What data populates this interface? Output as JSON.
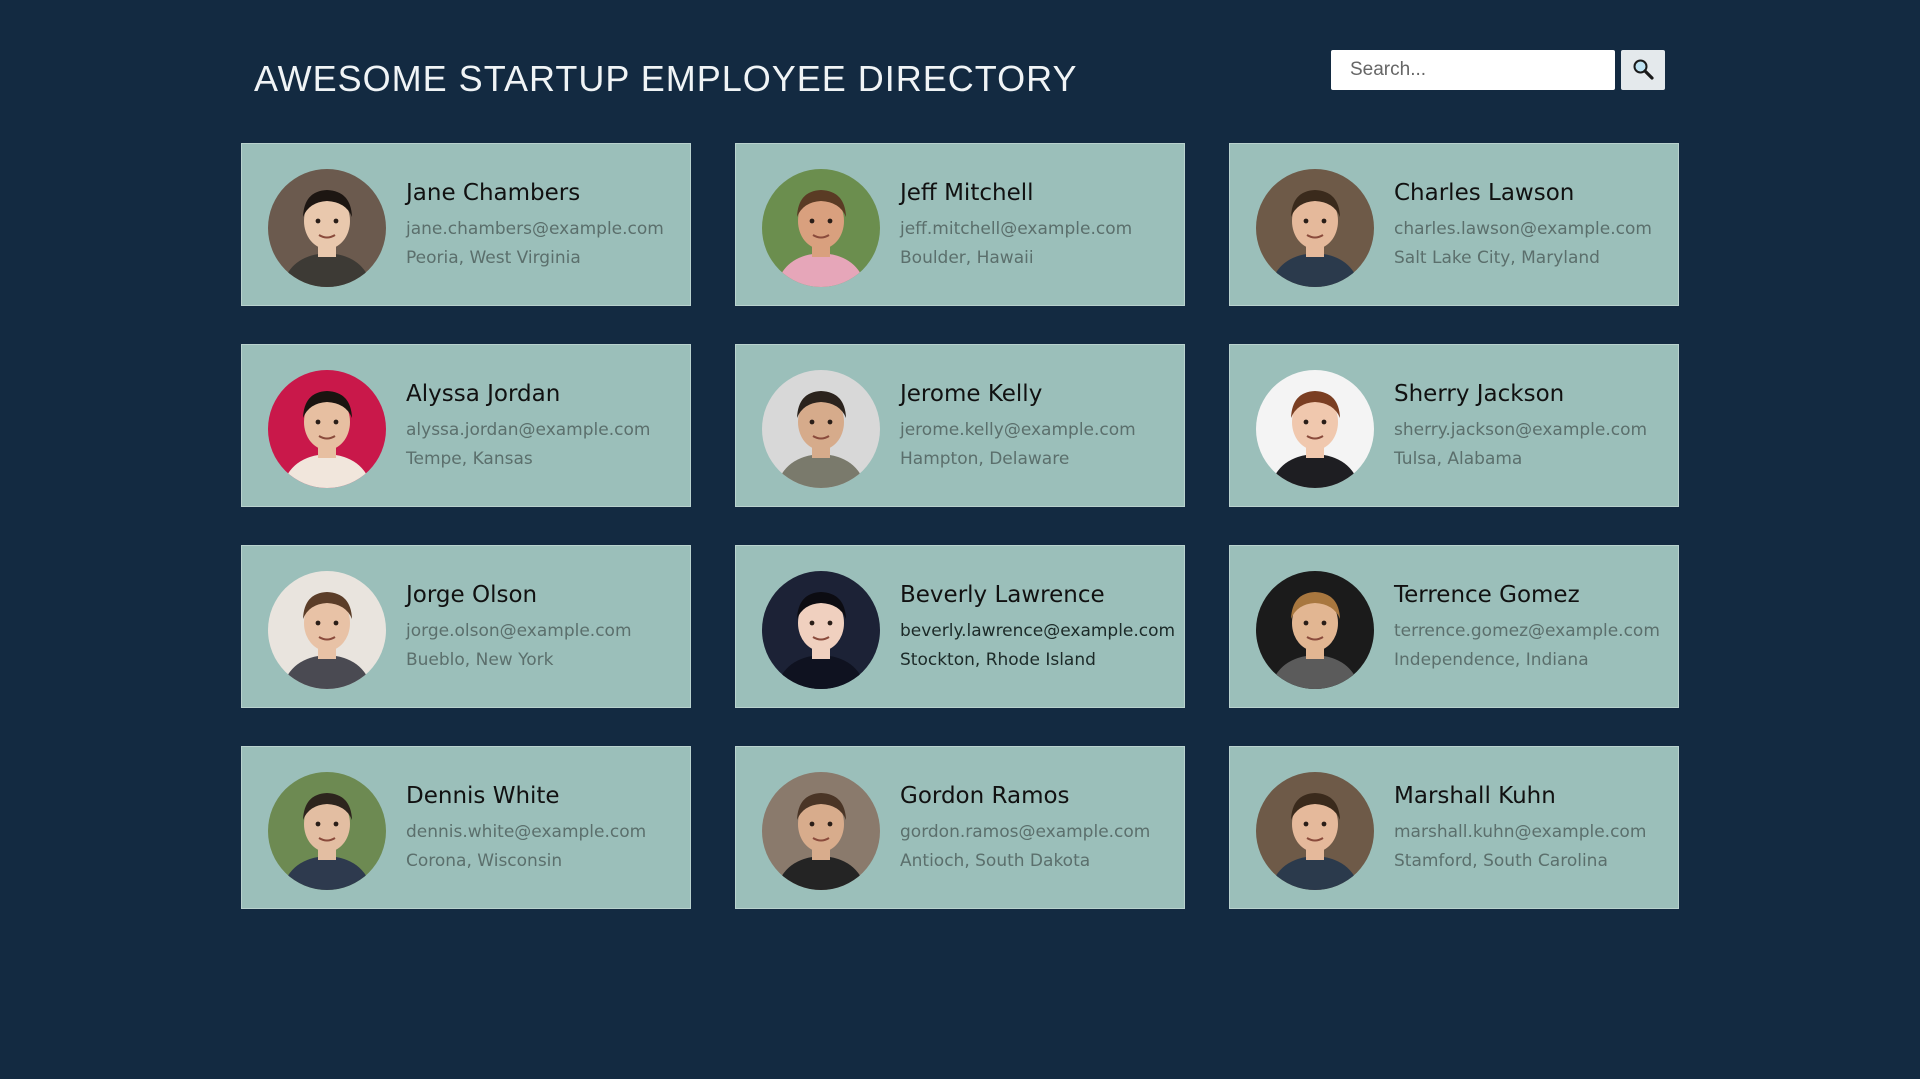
{
  "header": {
    "title": "Awesome Startup Employee Directory",
    "search_placeholder": "Search...",
    "search_icon": "magnifier-icon"
  },
  "colors": {
    "background": "#132a41",
    "card": "#9bbfba",
    "title": "#f0f4f6"
  },
  "employees": [
    {
      "name": "Jane Chambers",
      "email": "jane.chambers@example.com",
      "location": "Peoria, West Virginia",
      "avatar": {
        "bg": "#6b5a4e",
        "skin": "#e9c8ad",
        "hair": "#1d1612",
        "shirt": "#3d3a35"
      }
    },
    {
      "name": "Jeff Mitchell",
      "email": "jeff.mitchell@example.com",
      "location": "Boulder, Hawaii",
      "avatar": {
        "bg": "#6b8e4e",
        "skin": "#d9a07e",
        "hair": "#5a3b24",
        "shirt": "#e6a6b9"
      }
    },
    {
      "name": "Charles Lawson",
      "email": "charles.lawson@example.com",
      "location": "Salt Lake City, Maryland",
      "avatar": {
        "bg": "#6e5a48",
        "skin": "#e5b99b",
        "hair": "#3a2a1c",
        "shirt": "#2b3a4c"
      }
    },
    {
      "name": "Alyssa Jordan",
      "email": "alyssa.jordan@example.com",
      "location": "Tempe, Kansas",
      "avatar": {
        "bg": "#c9184a",
        "skin": "#e7bfa1",
        "hair": "#1a1410",
        "shirt": "#f1e6dc"
      }
    },
    {
      "name": "Jerome Kelly",
      "email": "jerome.kelly@example.com",
      "location": "Hampton, Delaware",
      "avatar": {
        "bg": "#d8d8d8",
        "skin": "#d6ab8b",
        "hair": "#2b231d",
        "shirt": "#7a7a6c"
      }
    },
    {
      "name": "Sherry Jackson",
      "email": "sherry.jackson@example.com",
      "location": "Tulsa, Alabama",
      "avatar": {
        "bg": "#f4f4f4",
        "skin": "#f0c8ae",
        "hair": "#7a3e22",
        "shirt": "#1e1e22"
      }
    },
    {
      "name": "Jorge Olson",
      "email": "jorge.olson@example.com",
      "location": "Bueblo, New York",
      "avatar": {
        "bg": "#e9e4de",
        "skin": "#e8c2a6",
        "hair": "#5b3d28",
        "shirt": "#4a4a52"
      }
    },
    {
      "name": "Beverly Lawrence",
      "email": "beverly.lawrence@example.com",
      "location": "Stockton, Rhode Island",
      "avatar": {
        "bg": "#1c2236",
        "skin": "#f0d0bf",
        "hair": "#0c0c12",
        "shirt": "#0f1220"
      },
      "dark_text": true
    },
    {
      "name": "Terrence Gomez",
      "email": "terrence.gomez@example.com",
      "location": "Independence, Indiana",
      "avatar": {
        "bg": "#1b1b1b",
        "skin": "#e2b692",
        "hair": "#a8773f",
        "shirt": "#5b5b5b"
      }
    },
    {
      "name": "Dennis White",
      "email": "dennis.white@example.com",
      "location": "Corona, Wisconsin",
      "avatar": {
        "bg": "#6d8a52",
        "skin": "#e3bea2",
        "hair": "#2d241d",
        "shirt": "#2e3a4e"
      }
    },
    {
      "name": "Gordon Ramos",
      "email": "gordon.ramos@example.com",
      "location": "Antioch, South Dakota",
      "avatar": {
        "bg": "#8a7a6c",
        "skin": "#d8ac8c",
        "hair": "#4a3526",
        "shirt": "#242424"
      }
    },
    {
      "name": "Marshall Kuhn",
      "email": "marshall.kuhn@example.com",
      "location": "Stamford, South Carolina",
      "avatar": {
        "bg": "#6e5a48",
        "skin": "#e5b99b",
        "hair": "#3a2a1c",
        "shirt": "#2b3a4c"
      }
    }
  ]
}
